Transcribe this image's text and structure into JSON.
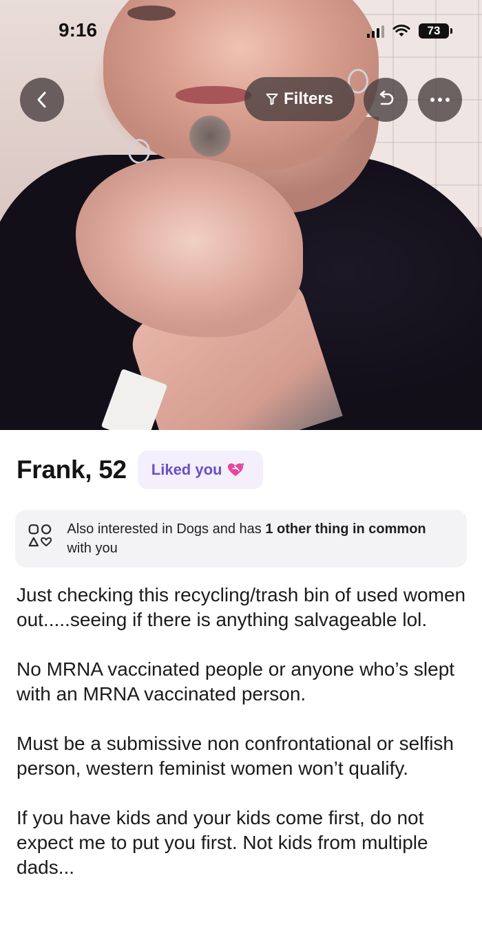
{
  "status_bar": {
    "time": "9:16",
    "battery": "73",
    "icons": [
      "signal-icon",
      "wifi-icon",
      "battery-icon"
    ]
  },
  "top_bar": {
    "back_icon": "chevron-left-icon",
    "filters_label": "Filters",
    "filters_icon": "funnel-icon",
    "undo_icon": "undo-icon",
    "more_icon": "more-horizontal-icon"
  },
  "profile": {
    "name_age": "Frank, 52",
    "liked_badge": "Liked you",
    "liked_icon": "heart-sparkle-icon",
    "common": {
      "icon": "shapes-icon",
      "prefix": "Also interested in Dogs and has ",
      "bold": "1 other thing in common",
      "suffix": " with you"
    },
    "bio": [
      "Just checking this recycling/trash bin of used women out.....seeing if there is anything salvageable lol.",
      "No MRNA vaccinated people or anyone who’s slept with an MRNA vaccinated person.",
      "Must be a submissive non confrontational or selfish person,  western feminist women won’t qualify.",
      "If you have kids and your kids come first, do not expect me to put you first. Not kids from multiple dads..."
    ]
  },
  "colors": {
    "badge_bg": "#f3effb",
    "badge_text": "#6b4fc5",
    "heart": "#e8459b",
    "overlay_button": "#463c3e"
  }
}
